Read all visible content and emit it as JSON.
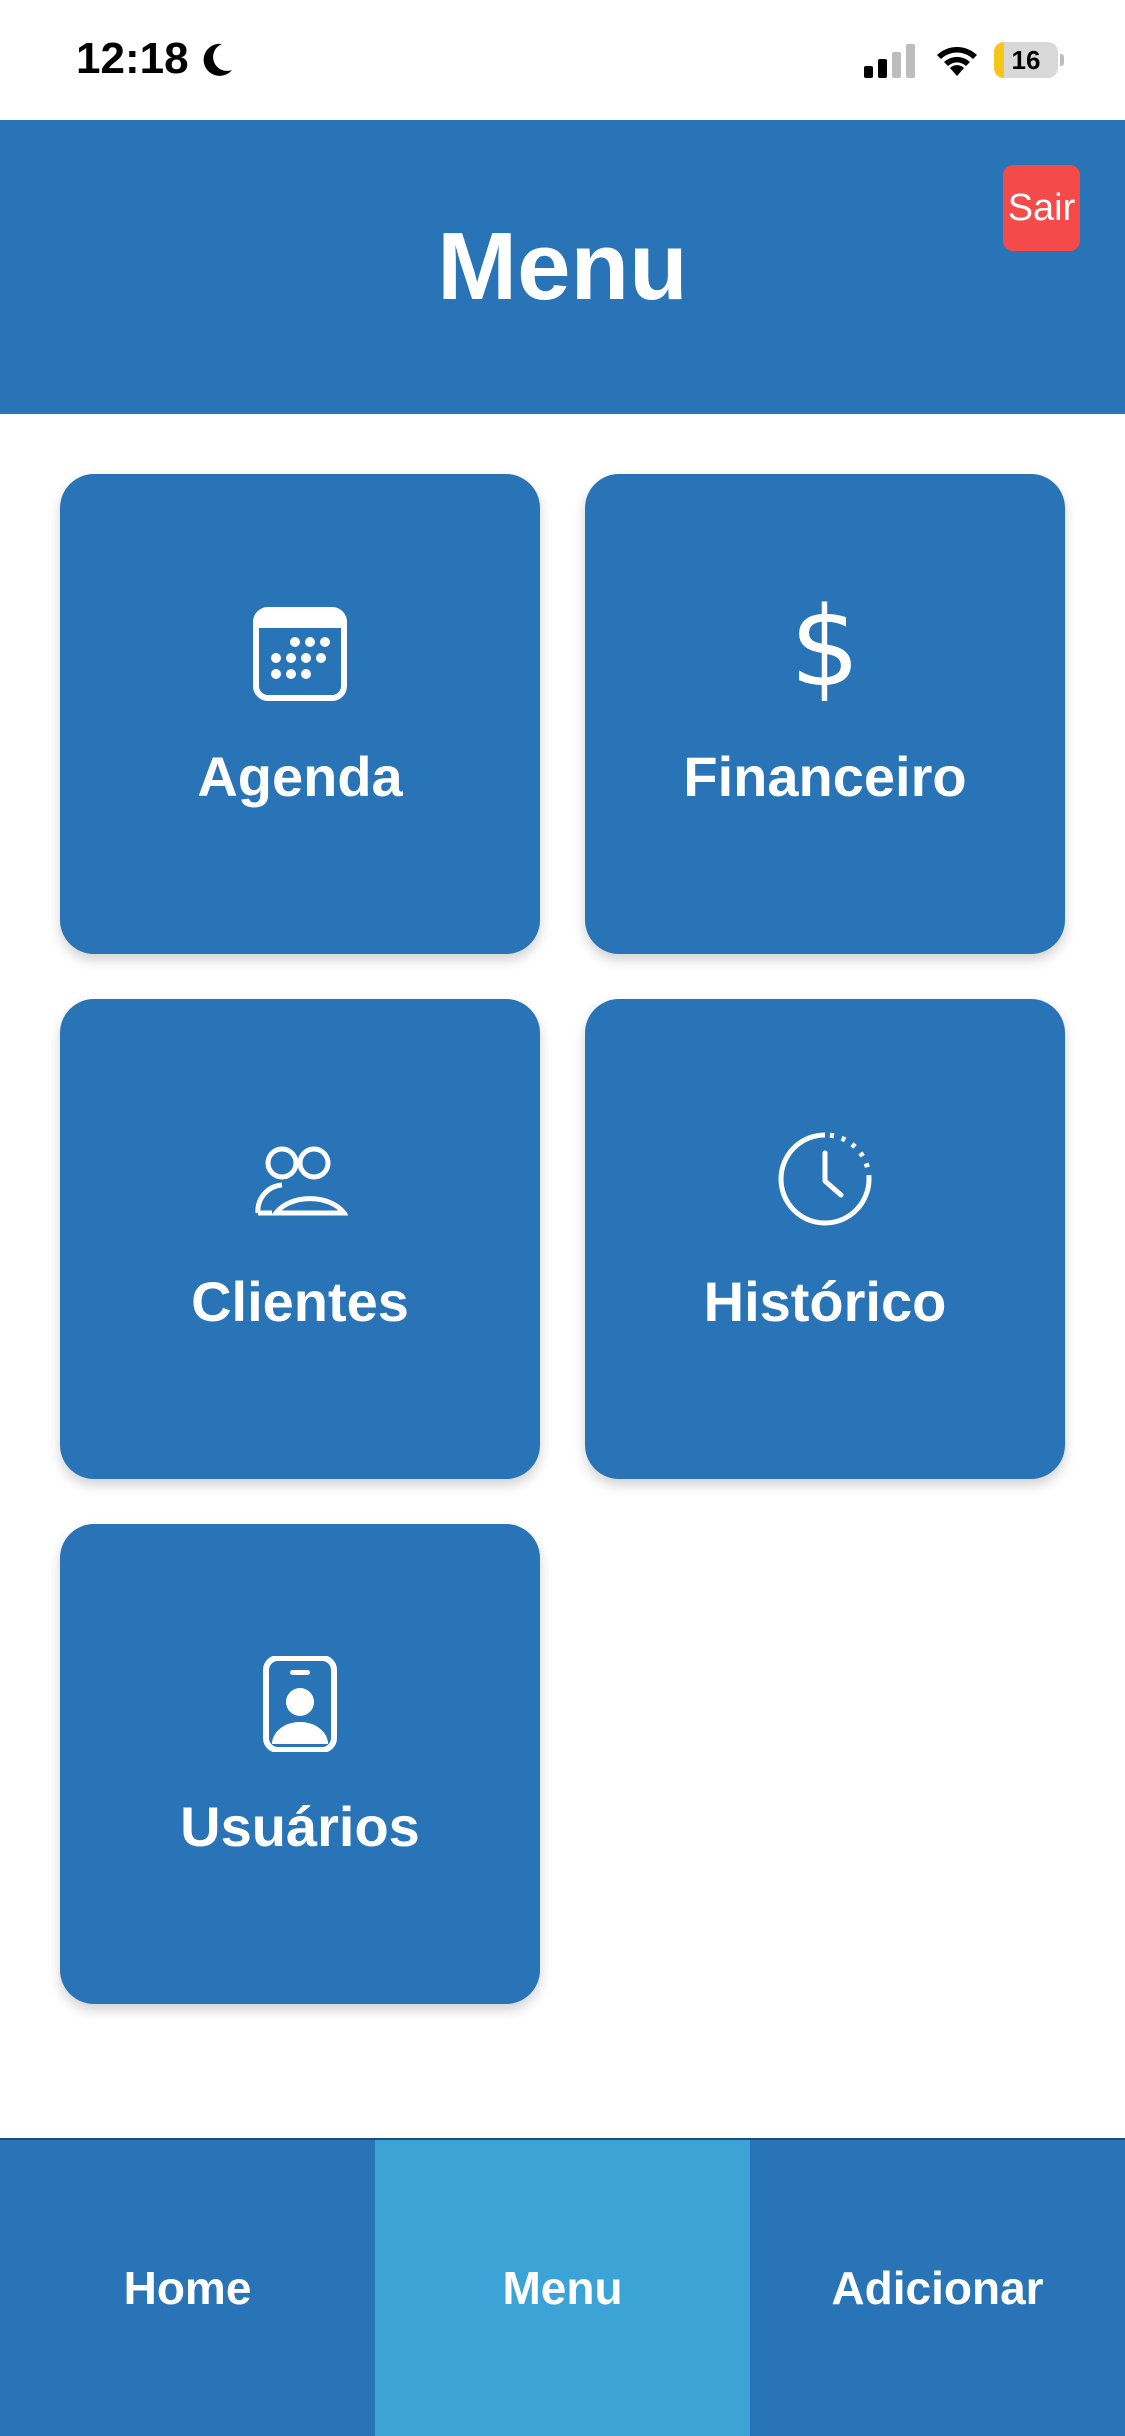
{
  "status_bar": {
    "time": "12:18",
    "battery_percent": 16,
    "battery_text": "16",
    "icons": [
      "moon-icon",
      "cellular-signal-icon",
      "wifi-icon",
      "battery-charging-icon"
    ]
  },
  "header": {
    "title": "Menu",
    "logout_label": "Sair"
  },
  "tiles": [
    {
      "label": "Agenda",
      "icon": "calendar-icon"
    },
    {
      "label": "Financeiro",
      "icon": "dollar-icon",
      "glyph": "$"
    },
    {
      "label": "Clientes",
      "icon": "users-icon"
    },
    {
      "label": "Histórico",
      "icon": "clock-history-icon"
    },
    {
      "label": "Usuários",
      "icon": "id-badge-icon"
    }
  ],
  "bottom_nav": {
    "items": [
      {
        "label": "Home",
        "active": false
      },
      {
        "label": "Menu",
        "active": true
      },
      {
        "label": "Adicionar",
        "active": false
      }
    ]
  },
  "colors": {
    "primary": "#2874b7",
    "active_tab": "#3ba3d6",
    "logout": "#f44a4a",
    "background": "#ffffff"
  }
}
